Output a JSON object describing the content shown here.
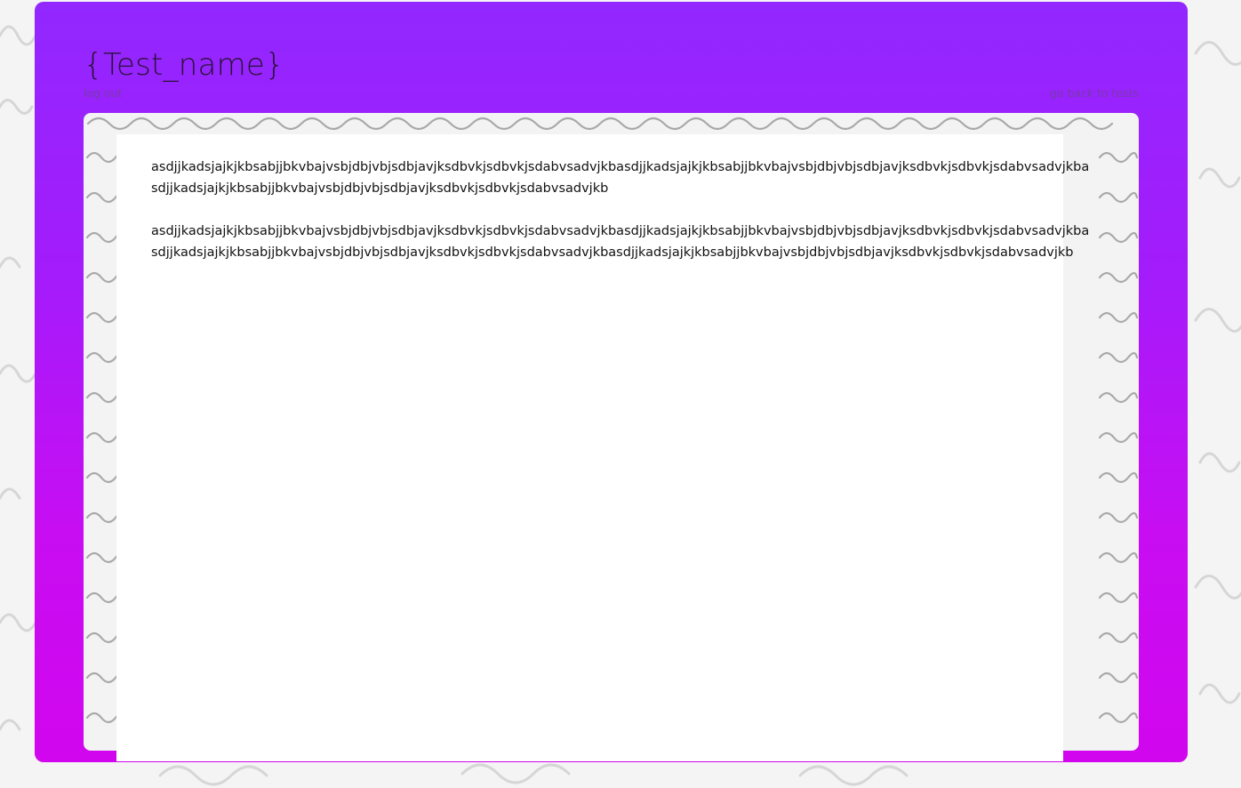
{
  "header": {
    "title": "{Test_name}",
    "logout_label": "log out",
    "back_label": "go back to tests"
  },
  "content": {
    "paragraphs": [
      "asdjjkadsjajkjkbsabjjbkvbajvsbjdbjvbjsdbjavjksdbvkjsdbvkjsdabvsadvjkbasdjjkadsjajkjkbsabjjbkvbajvsbjdbjvbjsdbjavjksdbvkjsdbvkjsdabvsadvjkbasdjjkadsjajkjkbsabjjbkvbajvsbjdbjvbjsdbjavjksdbvkjsdbvkjsdabvsadvjkb",
      "asdjjkadsjajkjkbsabjjbkvbajvsbjdbjvbjsdbjavjksdbvkjsdbvkjsdabvsadvjkbasdjjkadsjajkjkbsabjjbkvbajvsbjdbjvbjsdbjavjksdbvkjsdbvkjsdabvsadvjkbasdjjkadsjajkjkbsabjjbkvbajvsbjdbjvbjsdbjavjksdbvkjsdbvkjsdabvsadvjkbasdjjkadsjajkjkbsabjjbkvbajvsbjdbjvbjsdbjavjksdbvkjsdbvkjsdabvsadvjkb"
    ]
  },
  "colors": {
    "card_gradient_top": "#9227ff",
    "card_gradient_bottom": "#d106ee",
    "title_text": "#2a1236",
    "link_text": "#7a3aa8",
    "body_text": "#111111"
  }
}
